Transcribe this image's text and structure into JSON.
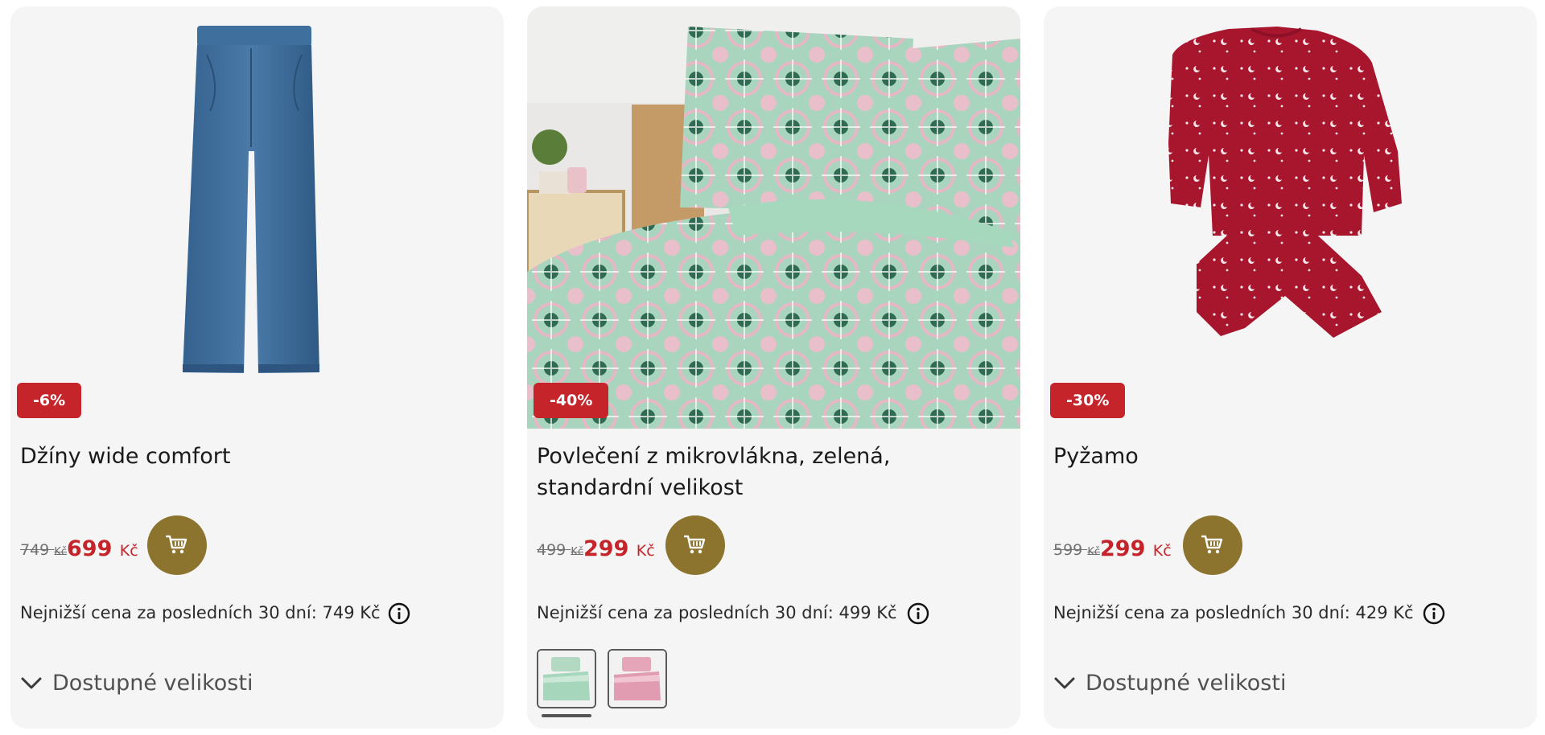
{
  "products": [
    {
      "badge": "-6%",
      "title": "Džíny wide comfort",
      "old_price": "749",
      "old_currency": "Kč",
      "new_price": "699",
      "new_currency": "Kč",
      "lowest_price_text": "Nejnižší cena za posledních 30 dní: 749 Kč",
      "sizes_label": "Dostupné velikosti"
    },
    {
      "badge": "-40%",
      "title": "Povlečení z mikrovlákna, zelená, standardní velikost",
      "old_price": "499",
      "old_currency": "Kč",
      "new_price": "299",
      "new_currency": "Kč",
      "lowest_price_text": "Nejnižší cena za posledních 30 dní: 499 Kč"
    },
    {
      "badge": "-30%",
      "title": "Pyžamo",
      "old_price": "599",
      "old_currency": "Kč",
      "new_price": "299",
      "new_currency": "Kč",
      "lowest_price_text": "Nejnižší cena za posledních 30 dní: 429 Kč",
      "sizes_label": "Dostupné velikosti"
    }
  ],
  "colors": {
    "card_bg": "#f5f5f5",
    "badge_bg": "#c5242b",
    "sale_price": "#c5242b",
    "cart_button": "#8c742f"
  },
  "icons": [
    "shopping-cart-icon",
    "info-icon",
    "chevron-down-icon"
  ]
}
